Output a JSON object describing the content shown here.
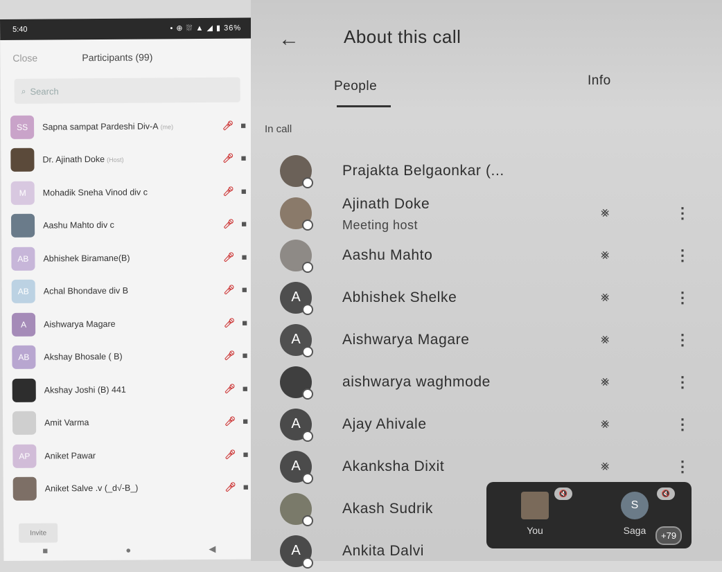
{
  "zoom": {
    "status": {
      "time": "5:40",
      "battery": "36%",
      "icons": "• ⊕ ⛆ ▲ ◢ ▮"
    },
    "header": {
      "close": "Close",
      "title": "Participants (99)"
    },
    "search": {
      "placeholder": "Search"
    },
    "participants": [
      {
        "initials": "SS",
        "name": "Sapna sampat Pardeshi Div-A",
        "tag": "(me)",
        "color": "#c9a3c9"
      },
      {
        "initials": "",
        "name": "Dr. Ajinath Doke",
        "tag": "(Host)",
        "color": "#5b4a3a"
      },
      {
        "initials": "M",
        "name": "Mohadik Sneha Vinod  div c",
        "tag": "",
        "color": "#d8c8e0"
      },
      {
        "initials": "",
        "name": "Aashu Mahto div c",
        "tag": "",
        "color": "#6a7b8a"
      },
      {
        "initials": "AB",
        "name": "Abhishek Biramane(B)",
        "tag": "",
        "color": "#c7b6d9"
      },
      {
        "initials": "AB",
        "name": "Achal Bhondave div B",
        "tag": "",
        "color": "#bcd2e3"
      },
      {
        "initials": "A",
        "name": "Aishwarya Magare",
        "tag": "",
        "color": "#a58bb8"
      },
      {
        "initials": "AB",
        "name": "Akshay Bhosale ( B)",
        "tag": "",
        "color": "#b8a6d0"
      },
      {
        "initials": "",
        "name": "Akshay Joshi (B) 441",
        "tag": "",
        "color": "#2d2d2d"
      },
      {
        "initials": "",
        "name": "Amit Varma",
        "tag": "",
        "color": "#cfcfcf"
      },
      {
        "initials": "AP",
        "name": "Aniket Pawar",
        "tag": "",
        "color": "#d1bcd8"
      },
      {
        "initials": "",
        "name": "Aniket Salve .v (_d√-B_)",
        "tag": "",
        "color": "#7d6f66"
      }
    ],
    "invite": "Invite"
  },
  "meet": {
    "title": "About this call",
    "tabs": {
      "people": "People",
      "info": "Info"
    },
    "section": "In call",
    "people": [
      {
        "initial": "",
        "name": "Prajakta Belgaonkar (...",
        "sub": "",
        "color": "#6b6158",
        "controls": false
      },
      {
        "initial": "",
        "name": "Ajinath Doke",
        "sub": "Meeting host",
        "color": "#8a7a6a",
        "controls": true
      },
      {
        "initial": "",
        "name": "Aashu Mahto",
        "sub": "",
        "color": "#8e8a86",
        "controls": true
      },
      {
        "initial": "A",
        "name": "Abhishek Shelke",
        "sub": "",
        "color": "#4e4e4e",
        "controls": true
      },
      {
        "initial": "A",
        "name": "Aishwarya Magare",
        "sub": "",
        "color": "#505050",
        "controls": true
      },
      {
        "initial": "",
        "name": "aishwarya waghmode",
        "sub": "",
        "color": "#3f3f3f",
        "controls": true
      },
      {
        "initial": "A",
        "name": "Ajay Ahivale",
        "sub": "",
        "color": "#4a4a4a",
        "controls": true
      },
      {
        "initial": "A",
        "name": "Akanksha Dixit",
        "sub": "",
        "color": "#4b4b4b",
        "controls": true
      },
      {
        "initial": "",
        "name": "Akash Sudrik",
        "sub": "",
        "color": "#7a7a6a",
        "controls": false
      },
      {
        "initial": "A",
        "name": "Ankita Dalvi",
        "sub": "",
        "color": "#4a4a4a",
        "controls": false
      }
    ],
    "overlay": {
      "you": "You",
      "other_initial": "S",
      "other": "Saga",
      "more": "+79"
    }
  }
}
